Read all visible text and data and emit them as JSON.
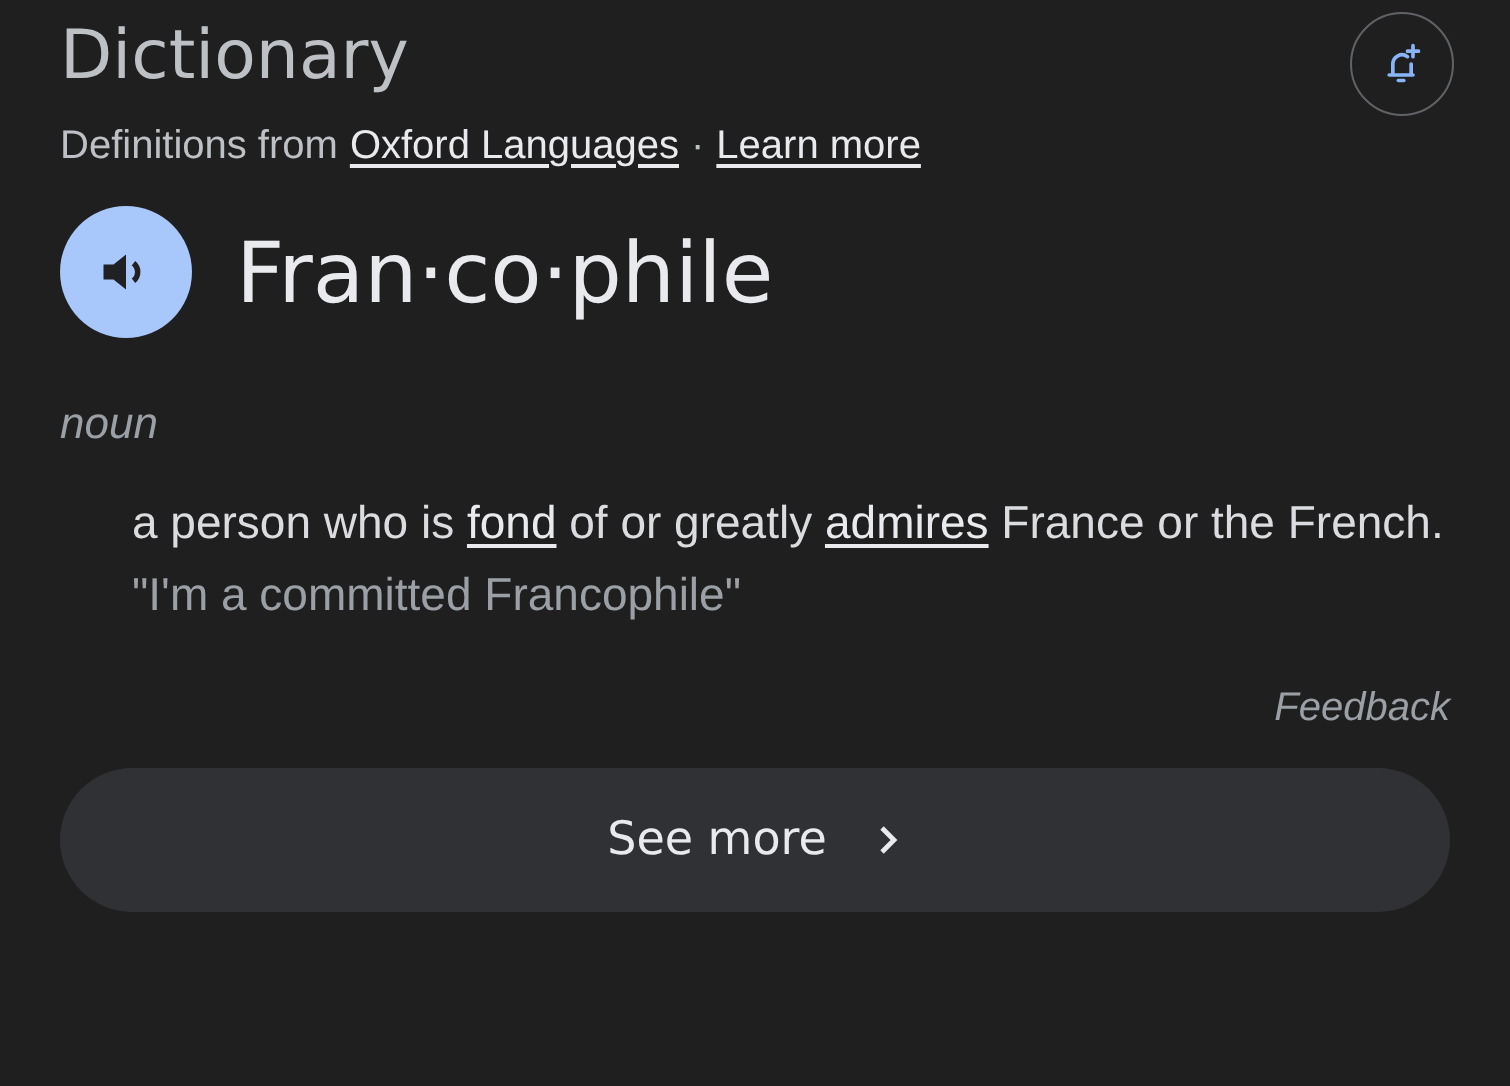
{
  "title": "Dictionary",
  "source": [
    {
      "kind": "text",
      "text": "Definitions from"
    },
    {
      "kind": "link",
      "text": "Oxford Languages"
    },
    {
      "kind": "text",
      "text": "·"
    },
    {
      "kind": "link",
      "text": "Learn more"
    }
  ],
  "word": "Fran·co·phile",
  "part_of_speech": "noun",
  "definition": [
    {
      "kind": "text",
      "text": "a person who is"
    },
    {
      "kind": "link",
      "text": "fond"
    },
    {
      "kind": "text",
      "text": "of or greatly"
    },
    {
      "kind": "link",
      "text": "admires"
    },
    {
      "kind": "text",
      "text": "France or the French."
    }
  ],
  "example": "\"I'm a committed Francophile\"",
  "feedback": "Feedback",
  "see_more": "See more"
}
